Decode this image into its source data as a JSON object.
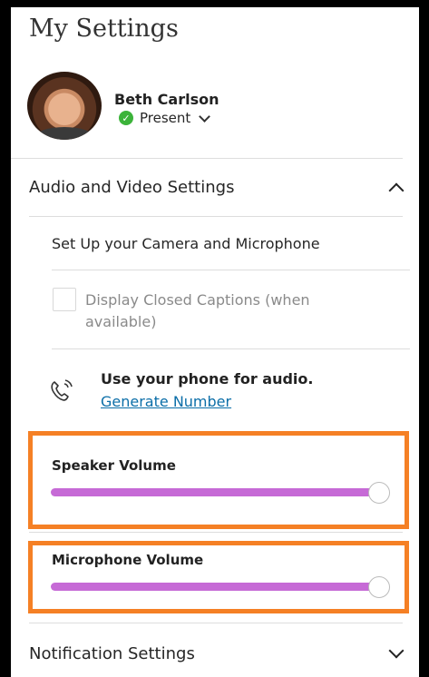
{
  "header": {
    "title": "My Settings"
  },
  "user": {
    "name": "Beth Carlson",
    "status": "Present"
  },
  "sections": {
    "audio_video": {
      "label": "Audio and Video Settings"
    },
    "notification": {
      "label": "Notification Settings"
    }
  },
  "audio_video": {
    "setup_label": "Set Up your Camera and Microphone",
    "captions_label": "Display Closed Captions (when available)",
    "captions_checked": false,
    "phone_title": "Use your phone for audio.",
    "phone_link": "Generate Number",
    "speaker_volume_label": "Speaker Volume",
    "speaker_volume_percent": 100,
    "microphone_volume_label": "Microphone Volume",
    "microphone_volume_percent": 100
  },
  "colors": {
    "slider_fill": "#c66ad6",
    "highlight_border": "#f58025",
    "status_ok": "#3cb33a",
    "link": "#0b6ea8"
  }
}
